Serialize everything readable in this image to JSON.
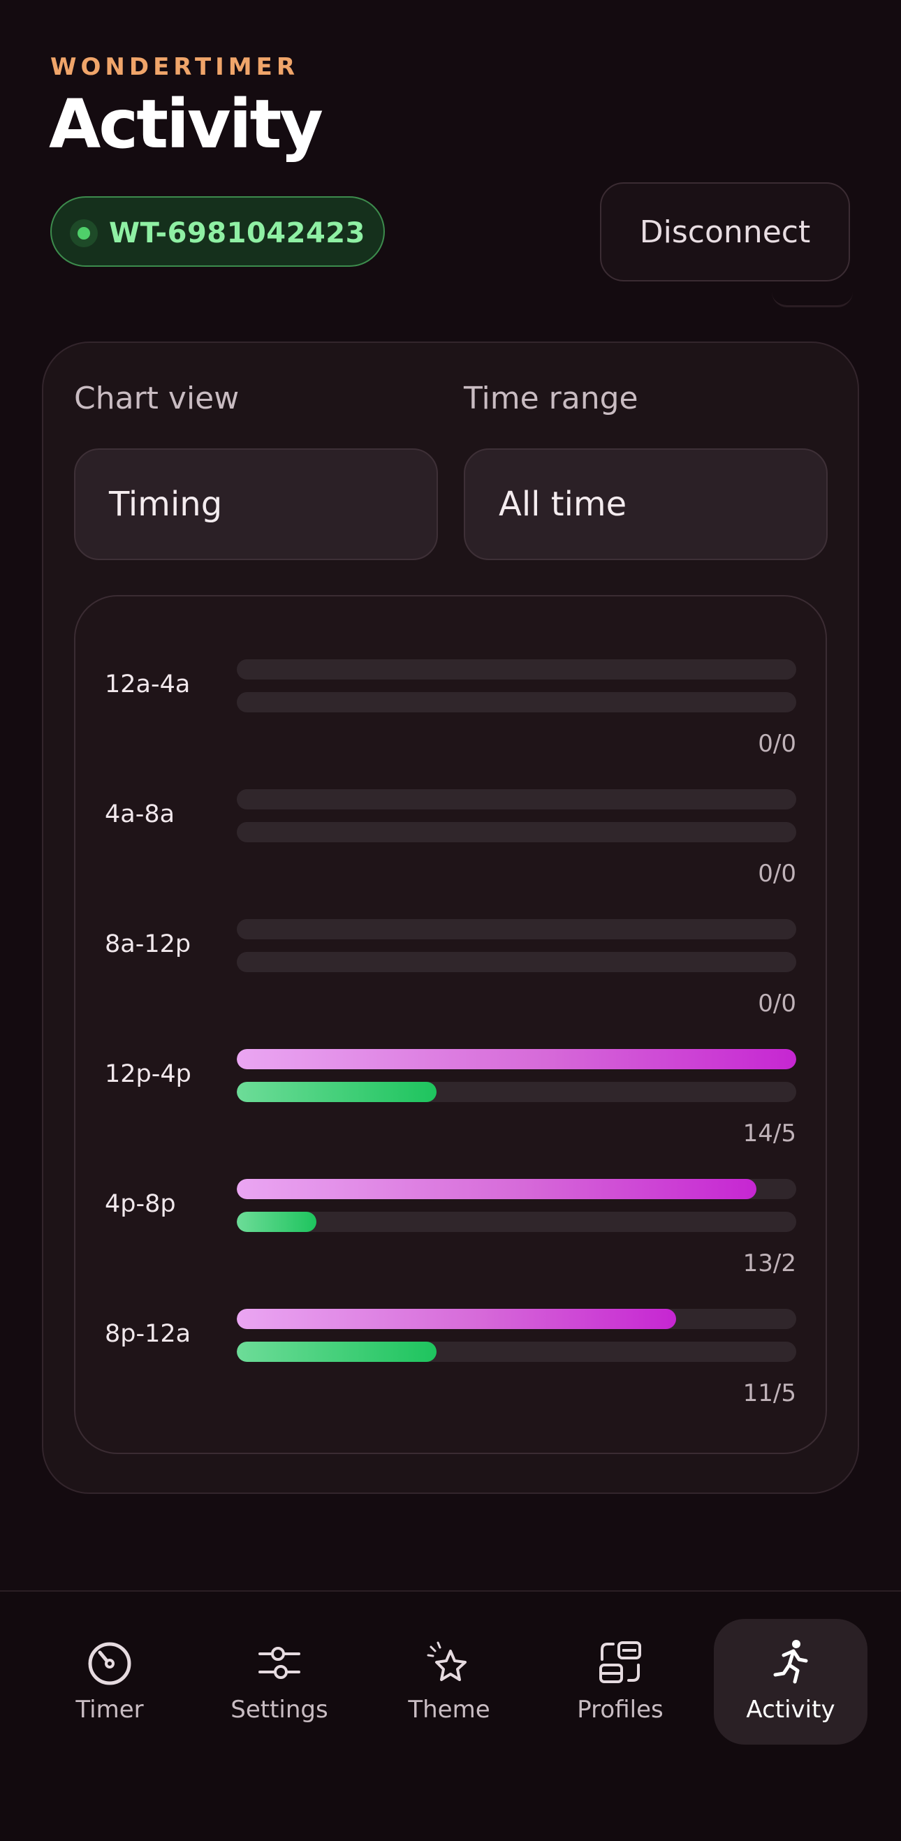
{
  "header": {
    "brand": "WONDERTIMER",
    "title": "Activity",
    "device_id": "WT-6981042423",
    "disconnect_label": "Disconnect"
  },
  "controls": {
    "chart_view_label": "Chart view",
    "chart_view_value": "Timing",
    "time_range_label": "Time range",
    "time_range_value": "All time"
  },
  "colors": {
    "accent_orange": "#f0a56a",
    "connected_green": "#8ff0a4",
    "pink_series": "#c626d2",
    "green_series": "#1ec45e"
  },
  "chart_data": {
    "type": "bar",
    "orientation": "horizontal",
    "categories": [
      "12a-4a",
      "4a-8a",
      "8a-12p",
      "12p-4p",
      "4p-8p",
      "8p-12a"
    ],
    "series": [
      {
        "values": [
          0,
          0,
          0,
          14,
          13,
          11
        ]
      },
      {
        "values": [
          0,
          0,
          0,
          5,
          2,
          5
        ]
      }
    ],
    "max": 14,
    "counts": [
      "0/0",
      "0/0",
      "0/0",
      "14/5",
      "13/2",
      "11/5"
    ]
  },
  "nav": {
    "items": [
      {
        "label": "Timer",
        "icon": "timer-icon"
      },
      {
        "label": "Settings",
        "icon": "sliders-icon"
      },
      {
        "label": "Theme",
        "icon": "sparkle-star-icon"
      },
      {
        "label": "Profiles",
        "icon": "profiles-icon"
      },
      {
        "label": "Activity",
        "icon": "running-person-icon"
      }
    ],
    "active": "Activity"
  }
}
